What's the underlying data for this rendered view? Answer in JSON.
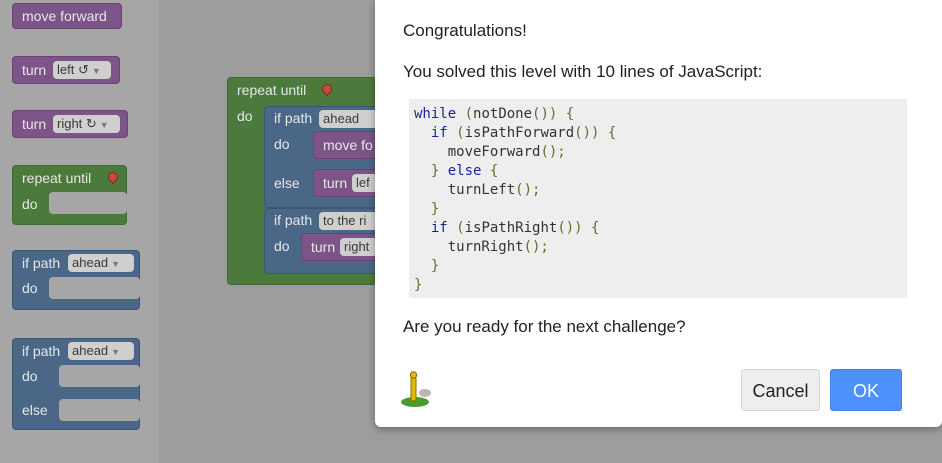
{
  "toolbox": {
    "move_forward": "move forward",
    "turn_left_label": "turn",
    "turn_left_value": "left ↺",
    "turn_right_label": "turn",
    "turn_right_value": "right ↻",
    "repeat_until": "repeat until",
    "repeat_do": "do",
    "ifpath1_label": "if path",
    "ifpath1_value": "ahead",
    "ifpath1_do": "do",
    "ifpath2_label": "if path",
    "ifpath2_value": "ahead",
    "ifpath2_do": "do",
    "ifpath2_else": "else"
  },
  "workspace": {
    "repeat_until": "repeat until",
    "repeat_do": "do",
    "if1_label": "if path",
    "if1_value": "ahead",
    "if1_do": "do",
    "if1_move": "move fo",
    "if1_else": "else",
    "if1_turn": "turn",
    "if1_turn_value": "lef",
    "if2_label": "if path",
    "if2_value": "to the ri",
    "if2_do": "do",
    "if2_turn": "turn",
    "if2_turn_value": "right"
  },
  "dialog": {
    "title": "Congratulations!",
    "message": "You solved this level with 10 lines of JavaScript:",
    "code_lines": [
      "while (notDone()) {",
      "  if (isPathForward()) {",
      "    moveForward();",
      "  } else {",
      "    turnLeft();",
      "  }",
      "  if (isPathRight()) {",
      "    turnRight();",
      "  }",
      "}"
    ],
    "next_prompt": "Are you ready for the next challenge?",
    "cancel_label": "Cancel",
    "ok_label": "OK"
  },
  "colors": {
    "ok_button": "#4d90fe",
    "move_block": "#7c5487",
    "loop_block": "#4c7a3c",
    "logic_block": "#4a6788"
  }
}
